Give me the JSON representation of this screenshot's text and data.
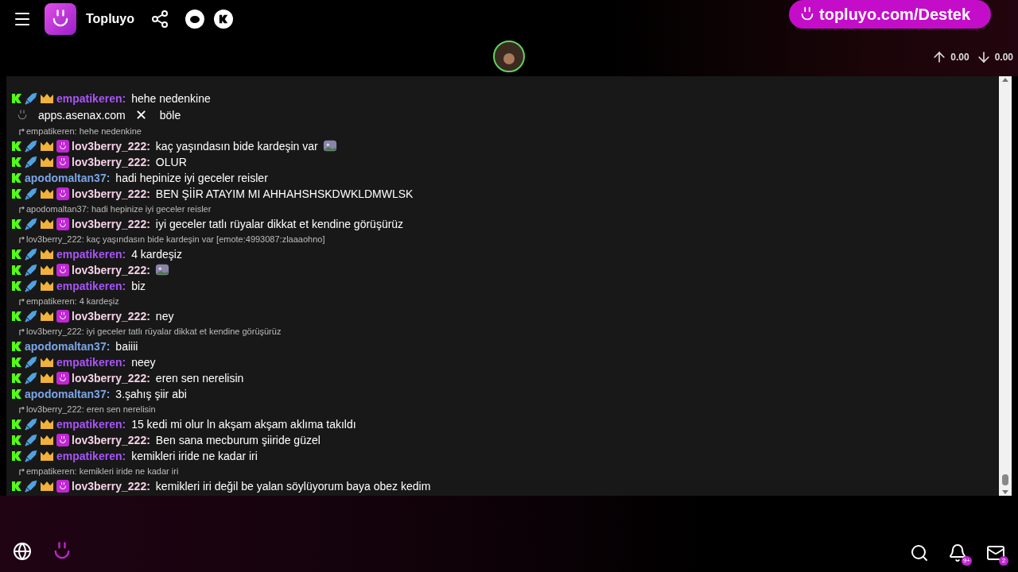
{
  "header": {
    "brand": "Topluyo",
    "banner": "topluyo.com/Destek",
    "upload": "0.00",
    "download": "0.00"
  },
  "popup": {
    "url": "apps.asenax.com",
    "close": "✕",
    "tail": "böle"
  },
  "chat": [
    {
      "kind": "message",
      "badges": [
        {
          "kind": "k"
        },
        {
          "kind": "sword"
        },
        {
          "kind": "crown"
        }
      ],
      "user": "empatikeren:",
      "color": "#a855f7",
      "text": "hehe nedenkine",
      "emote": false
    },
    {
      "kind": "popup"
    },
    {
      "kind": "reply",
      "text": "empatikeren: hehe nedenkine"
    },
    {
      "kind": "message",
      "badges": [
        {
          "kind": "k"
        },
        {
          "kind": "sword"
        },
        {
          "kind": "crown"
        },
        {
          "kind": "smile"
        }
      ],
      "user": "lov3berry_222:",
      "color": "#f5d0e6",
      "text": "kaç yaşındasın bide kardeşin var",
      "emote": true
    },
    {
      "kind": "message",
      "badges": [
        {
          "kind": "k"
        },
        {
          "kind": "sword"
        },
        {
          "kind": "crown"
        },
        {
          "kind": "smile"
        }
      ],
      "user": "lov3berry_222:",
      "color": "#f5d0e6",
      "text": "OLUR",
      "emote": false
    },
    {
      "kind": "message",
      "badges": [
        {
          "kind": "k"
        }
      ],
      "user": "apodomaltan37:",
      "color": "#7aa5e6",
      "text": "hadi hepinize iyi geceler reisler",
      "emote": false
    },
    {
      "kind": "message",
      "badges": [
        {
          "kind": "k"
        },
        {
          "kind": "sword"
        },
        {
          "kind": "crown"
        },
        {
          "kind": "smile"
        }
      ],
      "user": "lov3berry_222:",
      "color": "#f5d0e6",
      "text": "BEN ŞİİR ATAYIM MI AHHAHSHSKDWKLDMWLSK",
      "emote": false
    },
    {
      "kind": "reply",
      "text": "apodomaltan37: hadi hepinize iyi geceler reisler"
    },
    {
      "kind": "message",
      "badges": [
        {
          "kind": "k"
        },
        {
          "kind": "sword"
        },
        {
          "kind": "crown"
        },
        {
          "kind": "smile"
        }
      ],
      "user": "lov3berry_222:",
      "color": "#f5d0e6",
      "text": "iyi geceler tatlı rüyalar dikkat et kendine görüşürüz",
      "emote": false
    },
    {
      "kind": "reply",
      "text": "lov3berry_222: kaç yaşındasın bide kardeşin var [emote:4993087:zlaaaohno]"
    },
    {
      "kind": "message",
      "badges": [
        {
          "kind": "k"
        },
        {
          "kind": "sword"
        },
        {
          "kind": "crown"
        }
      ],
      "user": "empatikeren:",
      "color": "#a855f7",
      "text": "4 kardeşiz",
      "emote": false
    },
    {
      "kind": "message",
      "badges": [
        {
          "kind": "k"
        },
        {
          "kind": "sword"
        },
        {
          "kind": "crown"
        },
        {
          "kind": "smile"
        }
      ],
      "user": "lov3berry_222:",
      "color": "#f5d0e6",
      "emote": true
    },
    {
      "kind": "message",
      "badges": [
        {
          "kind": "k"
        },
        {
          "kind": "sword"
        },
        {
          "kind": "crown"
        }
      ],
      "user": "empatikeren:",
      "color": "#a855f7",
      "text": "biz",
      "emote": false
    },
    {
      "kind": "reply",
      "text": "empatikeren: 4 kardeşiz"
    },
    {
      "kind": "message",
      "badges": [
        {
          "kind": "k"
        },
        {
          "kind": "sword"
        },
        {
          "kind": "crown"
        },
        {
          "kind": "smile"
        }
      ],
      "user": "lov3berry_222:",
      "color": "#f5d0e6",
      "text": "ney",
      "emote": false
    },
    {
      "kind": "reply",
      "text": "lov3berry_222: iyi geceler tatlı rüyalar dikkat et kendine görüşürüz"
    },
    {
      "kind": "message",
      "badges": [
        {
          "kind": "k"
        }
      ],
      "user": "apodomaltan37:",
      "color": "#7aa5e6",
      "text": "baiiii",
      "emote": false
    },
    {
      "kind": "message",
      "badges": [
        {
          "kind": "k"
        },
        {
          "kind": "sword"
        },
        {
          "kind": "crown"
        }
      ],
      "user": "empatikeren:",
      "color": "#a855f7",
      "text": "neey",
      "emote": false
    },
    {
      "kind": "message",
      "badges": [
        {
          "kind": "k"
        },
        {
          "kind": "sword"
        },
        {
          "kind": "crown"
        },
        {
          "kind": "smile"
        }
      ],
      "user": "lov3berry_222:",
      "color": "#f5d0e6",
      "text": "eren sen nerelisin",
      "emote": false
    },
    {
      "kind": "message",
      "badges": [
        {
          "kind": "k"
        }
      ],
      "user": "apodomaltan37:",
      "color": "#7aa5e6",
      "text": "3.şahış şiir abi",
      "emote": false
    },
    {
      "kind": "reply",
      "text": "lov3berry_222: eren sen nerelisin"
    },
    {
      "kind": "message",
      "badges": [
        {
          "kind": "k"
        },
        {
          "kind": "sword"
        },
        {
          "kind": "crown"
        }
      ],
      "user": "empatikeren:",
      "color": "#a855f7",
      "text": "15 kedi mi olur ln akşam akşam aklıma takıldı",
      "emote": false
    },
    {
      "kind": "message",
      "badges": [
        {
          "kind": "k"
        },
        {
          "kind": "sword"
        },
        {
          "kind": "crown"
        },
        {
          "kind": "smile"
        }
      ],
      "user": "lov3berry_222:",
      "color": "#f5d0e6",
      "text": "Ben sana mecburum şiiride güzel",
      "emote": false
    },
    {
      "kind": "message",
      "badges": [
        {
          "kind": "k"
        },
        {
          "kind": "sword"
        },
        {
          "kind": "crown"
        }
      ],
      "user": "empatikeren:",
      "color": "#a855f7",
      "text": "kemikleri iride ne kadar iri",
      "emote": false
    },
    {
      "kind": "reply",
      "text": "empatikeren: kemikleri iride ne kadar iri"
    },
    {
      "kind": "message",
      "badges": [
        {
          "kind": "k"
        },
        {
          "kind": "sword"
        },
        {
          "kind": "crown"
        },
        {
          "kind": "smile"
        }
      ],
      "user": "lov3berry_222:",
      "color": "#f5d0e6",
      "text": "kemikleri iri değil be yalan söylüyorum baya obez kedim",
      "emote": false
    }
  ],
  "footer": {
    "notifications": "9+",
    "messages": "2"
  }
}
